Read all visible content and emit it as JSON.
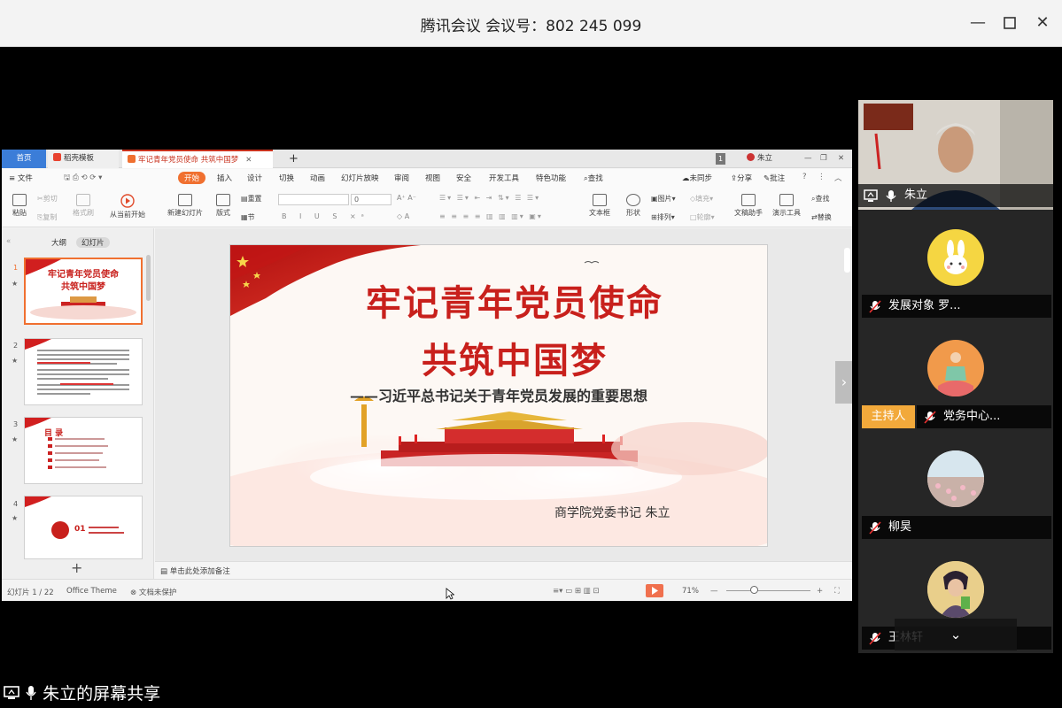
{
  "window": {
    "title": "腾讯会议 会议号：802 245 099"
  },
  "wps": {
    "tabs": {
      "home": "首页",
      "daoke": "稻壳模板",
      "doc": "牢记青年党员使命 共筑中国梦",
      "new_tab": "+",
      "badge": "1",
      "user": "朱立"
    },
    "menus": [
      "文件",
      "开始",
      "插入",
      "设计",
      "切换",
      "动画",
      "幻灯片放映",
      "审阅",
      "视图",
      "安全",
      "开发工具",
      "特色功能",
      "查找"
    ],
    "menu_right": {
      "sync": "未同步",
      "share": "分享",
      "comment": "批注"
    },
    "ribbon": {
      "paste": "粘贴",
      "cut": "剪切",
      "copy": "复制",
      "format_painter": "格式刷",
      "from_current": "从当前开始",
      "new_slide": "新建幻灯片",
      "layout": "版式",
      "section": "节",
      "reset": "重置",
      "font_size": "0",
      "textbox": "文本框",
      "shape": "形状",
      "picture": "图片",
      "arrange": "排列",
      "fill": "填充",
      "outline": "轮廓",
      "doc_assistant": "文稿助手",
      "present_tools": "演示工具",
      "find": "查找",
      "replace": "替换"
    },
    "left_panel": {
      "outline_tab": "大纲",
      "slides_tab": "幻灯片",
      "add": "+"
    },
    "thumbs": [
      {
        "num": "1",
        "title1": "牢记青年党员使命",
        "title2": "共筑中国梦"
      },
      {
        "num": "2"
      },
      {
        "num": "3",
        "title": "目 录"
      },
      {
        "num": "4",
        "badge": "01"
      }
    ],
    "slide": {
      "title_line1": "牢记青年党员使命",
      "title_line2": "共筑中国梦",
      "subtitle": "——习近平总书记关于青年党员发展的重要思想",
      "author": "商学院党委书记   朱立"
    },
    "notes_placeholder": "单击此处添加备注",
    "status": {
      "slide_index": "幻灯片 1 / 22",
      "theme": "Office Theme",
      "protect": "文档未保护",
      "zoom": "71%"
    }
  },
  "participants": [
    {
      "name": "朱立",
      "kind": "video"
    },
    {
      "name": "发展对象 罗...",
      "kind": "avatar",
      "color": "#f5d642"
    },
    {
      "name": "党务中心...",
      "kind": "avatar",
      "host": "主持人",
      "color": "#f19a4b"
    },
    {
      "name": "柳昊",
      "kind": "avatar",
      "color": "#e8d9d6"
    },
    {
      "name": "王林轩",
      "kind": "avatar",
      "color": "#5a4a6b"
    }
  ],
  "screen_share_label": "朱立的屏幕共享"
}
